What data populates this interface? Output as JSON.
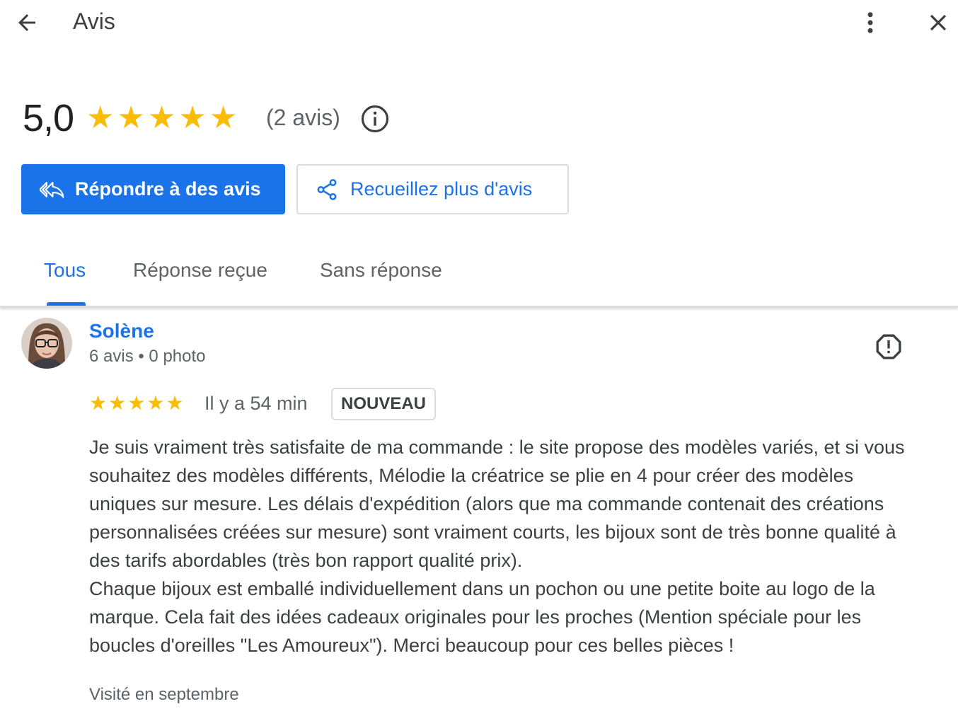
{
  "header": {
    "title": "Avis",
    "back_icon": "arrow-back-icon",
    "more_icon": "more-vertical-icon",
    "close_icon": "close-icon"
  },
  "summary": {
    "rating": "5,0",
    "stars": 5,
    "review_count": "(2 avis)",
    "info_icon": "info-icon"
  },
  "actions": {
    "reply_label": "Répondre à des avis",
    "reply_icon": "reply-all-icon",
    "collect_label": "Recueillez plus d'avis",
    "collect_icon": "share-icon"
  },
  "tabs": [
    {
      "label": "Tous",
      "active": true
    },
    {
      "label": "Réponse reçue",
      "active": false
    },
    {
      "label": "Sans réponse",
      "active": false
    }
  ],
  "review": {
    "author": "Solène",
    "meta": "6 avis • 0 photo",
    "stars": 5,
    "time": "Il y a 54 min",
    "badge": "NOUVEAU",
    "paragraphs": [
      "Je suis vraiment très satisfaite de ma commande : le site propose des modèles variés, et si vous souhaitez des modèles différents, Mélodie la créatrice se plie en 4 pour créer des modèles uniques sur mesure. Les délais d'expédition (alors que ma commande contenait des créations personnalisées créées sur mesure) sont vraiment courts, les bijoux sont de très bonne qualité à des tarifs abordables (très bon rapport qualité prix).",
      "Chaque bijoux est emballé individuellement dans un pochon ou une petite boite au logo de la marque. Cela fait des idées cadeaux originales pour les proches (Mention spéciale pour les boucles d'oreilles \"Les Amoureux\"). Merci beaucoup pour ces belles pièces !"
    ],
    "visited": "Visité en septembre",
    "flag_icon": "report-flag-icon"
  },
  "colors": {
    "accent": "#1a73e8",
    "star": "#fbbc04",
    "text_secondary": "#5f6368"
  }
}
